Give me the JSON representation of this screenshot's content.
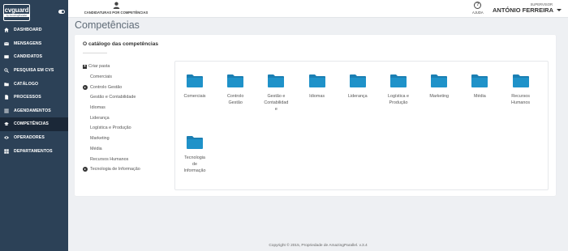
{
  "brand": {
    "logo_main": "cvguard",
    "logo_sub": "by AmazingParallel"
  },
  "sidebar": {
    "items": [
      {
        "label": "DASHBOARD",
        "icon": "home-icon"
      },
      {
        "label": "MENSAGENS",
        "icon": "envelope-icon"
      },
      {
        "label": "CANDIDATOS",
        "icon": "id-card-icon"
      },
      {
        "label": "PESQUISA EM CVS",
        "icon": "search-icon"
      },
      {
        "label": "CATÁLOGO",
        "icon": "folder-icon"
      },
      {
        "label": "PROCESSOS",
        "icon": "file-icon"
      },
      {
        "label": "AGENDAMENTOS",
        "icon": "list-icon"
      },
      {
        "label": "COMPETÊNCIAS",
        "icon": "graduation-cap-icon",
        "active": true
      },
      {
        "label": "OPERADORES",
        "icon": "eye-icon"
      },
      {
        "label": "DEPARTAMENTOS",
        "icon": "grid-icon"
      }
    ]
  },
  "topbar": {
    "center_label": "CANDIDATURAS POR COMPETÊNCIAS",
    "help_glyph": "?",
    "help_label": "AJUDA",
    "user_role": "SUPERVISOR",
    "user_name": "ANTÓNIO FERREIRA"
  },
  "page": {
    "title": "Competências"
  },
  "card": {
    "title": "O catálogo das competências",
    "tree": {
      "root_label": "Criar pasta",
      "root_glyph": "+",
      "items": [
        {
          "label": "Comerciais",
          "type": "child"
        },
        {
          "label": "Controlo Gestão",
          "type": "branch"
        },
        {
          "label": "Gestão e Contabilidade",
          "type": "child"
        },
        {
          "label": "Idiomas",
          "type": "child"
        },
        {
          "label": "Liderança",
          "type": "child"
        },
        {
          "label": "Logística e Produção",
          "type": "child"
        },
        {
          "label": "Marketing",
          "type": "child"
        },
        {
          "label": "Média",
          "type": "child"
        },
        {
          "label": "Recursos Humanos",
          "type": "child"
        },
        {
          "label": "Tecnologia de Informação",
          "type": "branch"
        }
      ]
    },
    "folders": [
      {
        "lines": [
          "Comerciais"
        ]
      },
      {
        "lines": [
          "Controlo",
          "Gestão"
        ]
      },
      {
        "lines": [
          "Gestão e",
          "Contabilidad",
          "e"
        ]
      },
      {
        "lines": [
          "Idiomas"
        ]
      },
      {
        "lines": [
          "Liderança"
        ]
      },
      {
        "lines": [
          "Logística e",
          "Produção"
        ]
      },
      {
        "lines": [
          "Marketing"
        ]
      },
      {
        "lines": [
          "Média"
        ]
      },
      {
        "lines": [
          "Recursos",
          "Humanos"
        ]
      },
      {
        "lines": [
          "Tecnologia",
          "de",
          "Informação"
        ]
      }
    ]
  },
  "footer": {
    "text": "Copyright © 2015, Propriedade de AmazingParallel. v.3.4"
  },
  "colors": {
    "sidebar_bg": "#2c4157",
    "sidebar_active": "#1b2838",
    "folder_blue": "#1f92c9",
    "page_bg": "#eef0f3"
  }
}
